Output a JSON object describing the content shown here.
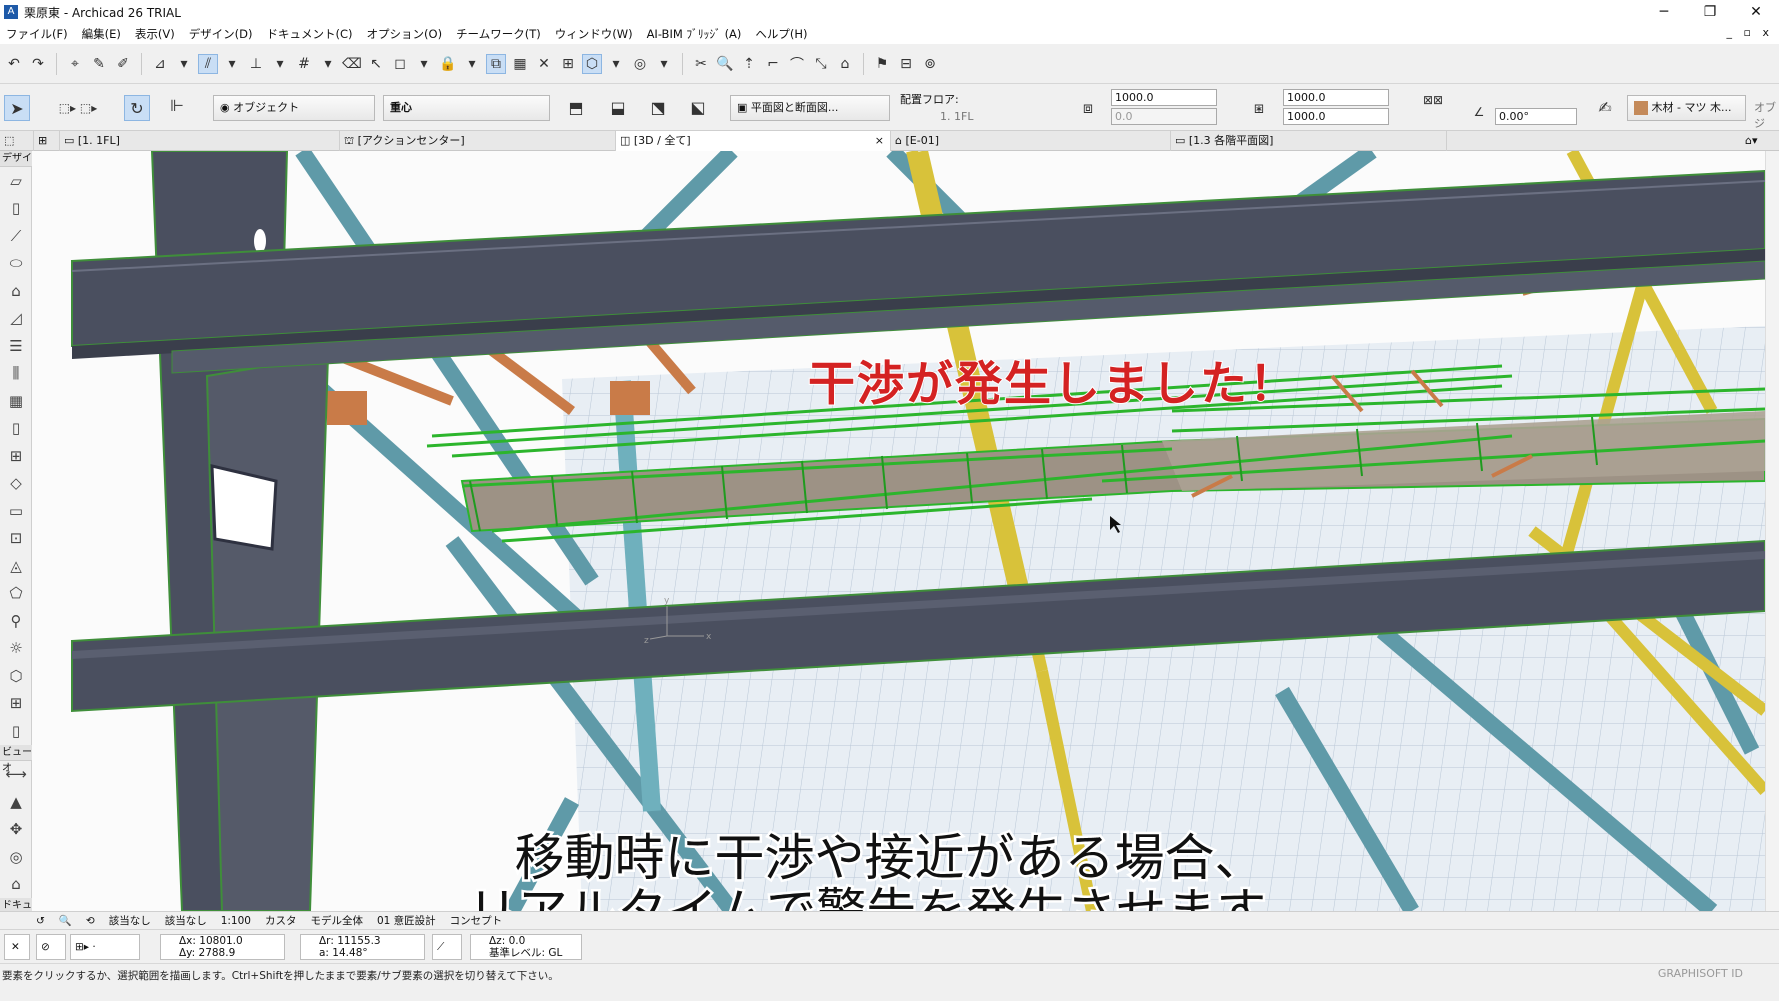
{
  "window": {
    "title": "栗原東 - Archicad 26 TRIAL",
    "minimize": "─",
    "restore": "❐",
    "close": "✕"
  },
  "menu": [
    "ファイル(F)",
    "編集(E)",
    "表示(V)",
    "デザイン(D)",
    "ドキュメント(C)",
    "オプション(O)",
    "チームワーク(T)",
    "ウィンドウ(W)",
    "AI-BIM ﾌﾞﾘｯｼﾞ (A)",
    "ヘルプ(H)"
  ],
  "mdi_controls": "_ ▫ x",
  "infobox": {
    "filter_label": "オブジェクト",
    "snap_label": "重心",
    "view_label": "平面図と断面図...",
    "floor_caption": "配置フロア:",
    "floor_value": "1. 1FL",
    "size_a": "1000.0",
    "size_a2": "0.0",
    "size_b": "1000.0",
    "size_b2": "1000.0",
    "angle": "0.00°",
    "material": "木材 - マツ 木...",
    "more": "オブジ"
  },
  "tabs": [
    {
      "label": "[1. 1FL]"
    },
    {
      "label": "[アクションセンター]"
    },
    {
      "label": "[3D / 全て]"
    },
    {
      "label": "[E-01]"
    },
    {
      "label": "[1.3 各階平面図]"
    }
  ],
  "toolbox": {
    "design_header": "デザイ",
    "view_header": "ビューオ",
    "doc_header": "ドキュ"
  },
  "bottombar": {
    "undefined1": "該当なし",
    "undefined2": "該当なし",
    "scale": "1:100",
    "custom": "カスタ",
    "model": "モデル全体",
    "std": "01 意匠設計",
    "layer": "コンセプト"
  },
  "coords": {
    "dx": "Δx: 10801.0",
    "dy": "Δy: 2788.9",
    "dr": "Δr: 11155.3",
    "a": "a: 14.48°",
    "dz": "Δz: 0.0",
    "ref": "基準レベル: GL"
  },
  "status": {
    "message": "要素をクリックするか、選択範囲を描画します。Ctrl+Shiftを押したままで要素/サブ要素の選択を切り替えて下さい。",
    "brand": "GRAPHISOFT ID"
  },
  "overlay": {
    "alert": "干渉が発生しました！",
    "caption_line1": "移動時に干渉や接近がある場合、",
    "caption_line2": "リアルタイムで警告を発生させます。"
  },
  "colors": {
    "beam": "#4a4f5f",
    "beam_edge": "#3f8e3a",
    "brace_blue": "#5f9aa8",
    "brace_yellow": "#d8c23a",
    "brace_orange": "#c97b48",
    "duct_green": "#2cb52c",
    "alert_red": "#d42222",
    "accent_blue": "#1e5aa8"
  }
}
